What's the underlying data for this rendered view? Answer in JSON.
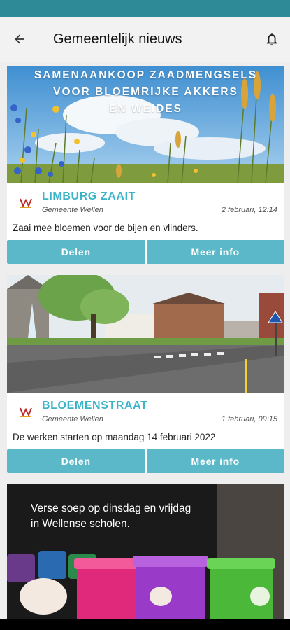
{
  "app": {
    "title": "Gemeentelijk nieuws"
  },
  "colors": {
    "accent": "#5ab8c9",
    "title": "#3bb3c8",
    "status_bar": "#2e8a96"
  },
  "icons": {
    "back": "arrow-left-icon",
    "notifications": "bell-icon"
  },
  "news": [
    {
      "image_caption": "SAMENAANKOOP ZAADMENGSELS VOOR BLOEMRIJKE AKKERS EN WEIDES",
      "image_lines": [
        "SAMENAANKOOP ZAADMENGSELS",
        "VOOR BLOEMRIJKE AKKERS",
        "EN WEIDES"
      ],
      "title": "LIMBURG ZAAIT",
      "source": "Gemeente Wellen",
      "date": "2 februari, 12:14",
      "description": "Zaai mee bloemen voor de bijen en vlinders.",
      "share_label": "Delen",
      "more_label": "Meer info"
    },
    {
      "title": "BLOEMENSTRAAT",
      "source": "Gemeente Wellen",
      "date": "1 februari, 09:15",
      "description": "De werken starten op maandag 14 februari 2022",
      "share_label": "Delen",
      "more_label": "Meer info"
    },
    {
      "image_lines": [
        "Verse soep op dinsdag en vrijdag",
        "in Wellense scholen."
      ]
    }
  ]
}
